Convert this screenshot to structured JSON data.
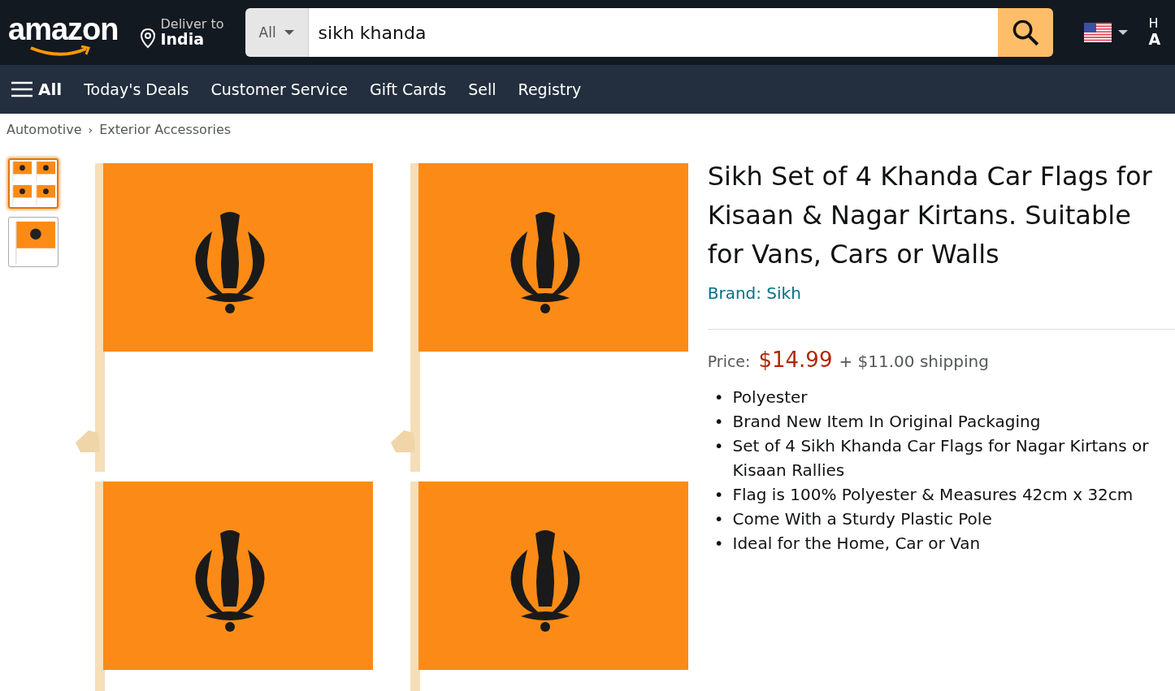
{
  "header": {
    "logo": "amazon",
    "deliver_label": "Deliver to",
    "deliver_location": "India",
    "search": {
      "category": "All",
      "value": "sikh khanda"
    },
    "account_line_1": "H",
    "account_line_2": "A"
  },
  "nav": {
    "menu_label": "All",
    "links": [
      "Today's Deals",
      "Customer Service",
      "Gift Cards",
      "Sell",
      "Registry"
    ]
  },
  "breadcrumb": [
    "Automotive",
    "Exterior Accessories"
  ],
  "breadcrumb_separator": "›",
  "thumbnails": [
    {
      "kind": "four",
      "selected": true
    },
    {
      "kind": "single",
      "selected": false
    }
  ],
  "product": {
    "title": "Sikh Set of 4 Khanda Car Flags for Kisaan & Nagar Kirtans. Suitable for Vans, Cars or Walls",
    "brand": "Brand: Sikh",
    "price_label": "Price:",
    "price": "$14.99",
    "shipping": "+ $11.00 shipping",
    "bullet_marker": "•",
    "bullets": [
      "Polyester",
      "Brand New Item In Original Packaging",
      "Set of 4 Sikh Khanda Car Flags for Nagar Kirtans or Kisaan Rallies",
      "Flag is 100% Polyester & Measures 42cm x 32cm",
      "Come With a Sturdy Plastic Pole",
      "Ideal for the Home, Car or Van"
    ]
  }
}
